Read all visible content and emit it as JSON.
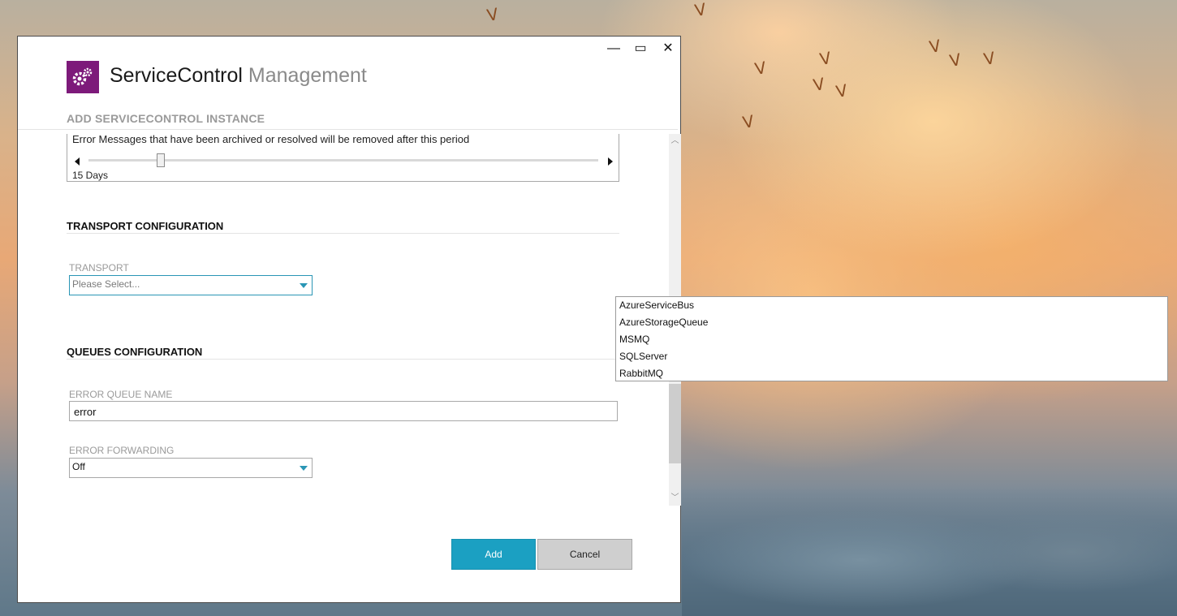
{
  "window": {
    "controls": {
      "minimize": "—",
      "maximize": "▭",
      "close": "✕"
    },
    "app_title": "ServiceControl",
    "app_title_muted": "Management",
    "subtitle": "ADD SERVICECONTROL INSTANCE"
  },
  "retention": {
    "description": "Error Messages that have been archived or resolved will be removed after this period",
    "value": "15 Days",
    "slider_fraction": 0.14
  },
  "transport": {
    "section_title": "TRANSPORT CONFIGURATION",
    "label": "TRANSPORT",
    "placeholder": "Please Select...",
    "options": [
      "AzureServiceBus",
      "AzureStorageQueue",
      "MSMQ",
      "SQLServer",
      "RabbitMQ"
    ]
  },
  "queues": {
    "section_title": "QUEUES CONFIGURATION",
    "error_queue_label": "ERROR QUEUE NAME",
    "error_queue_value": "error",
    "error_forwarding_label": "ERROR FORWARDING",
    "error_forwarding_value": "Off"
  },
  "buttons": {
    "add": "Add",
    "cancel": "Cancel"
  },
  "colors": {
    "accent": "#1ba0c2",
    "logo": "#7d1a7a",
    "focus_border": "#2a96b5"
  }
}
